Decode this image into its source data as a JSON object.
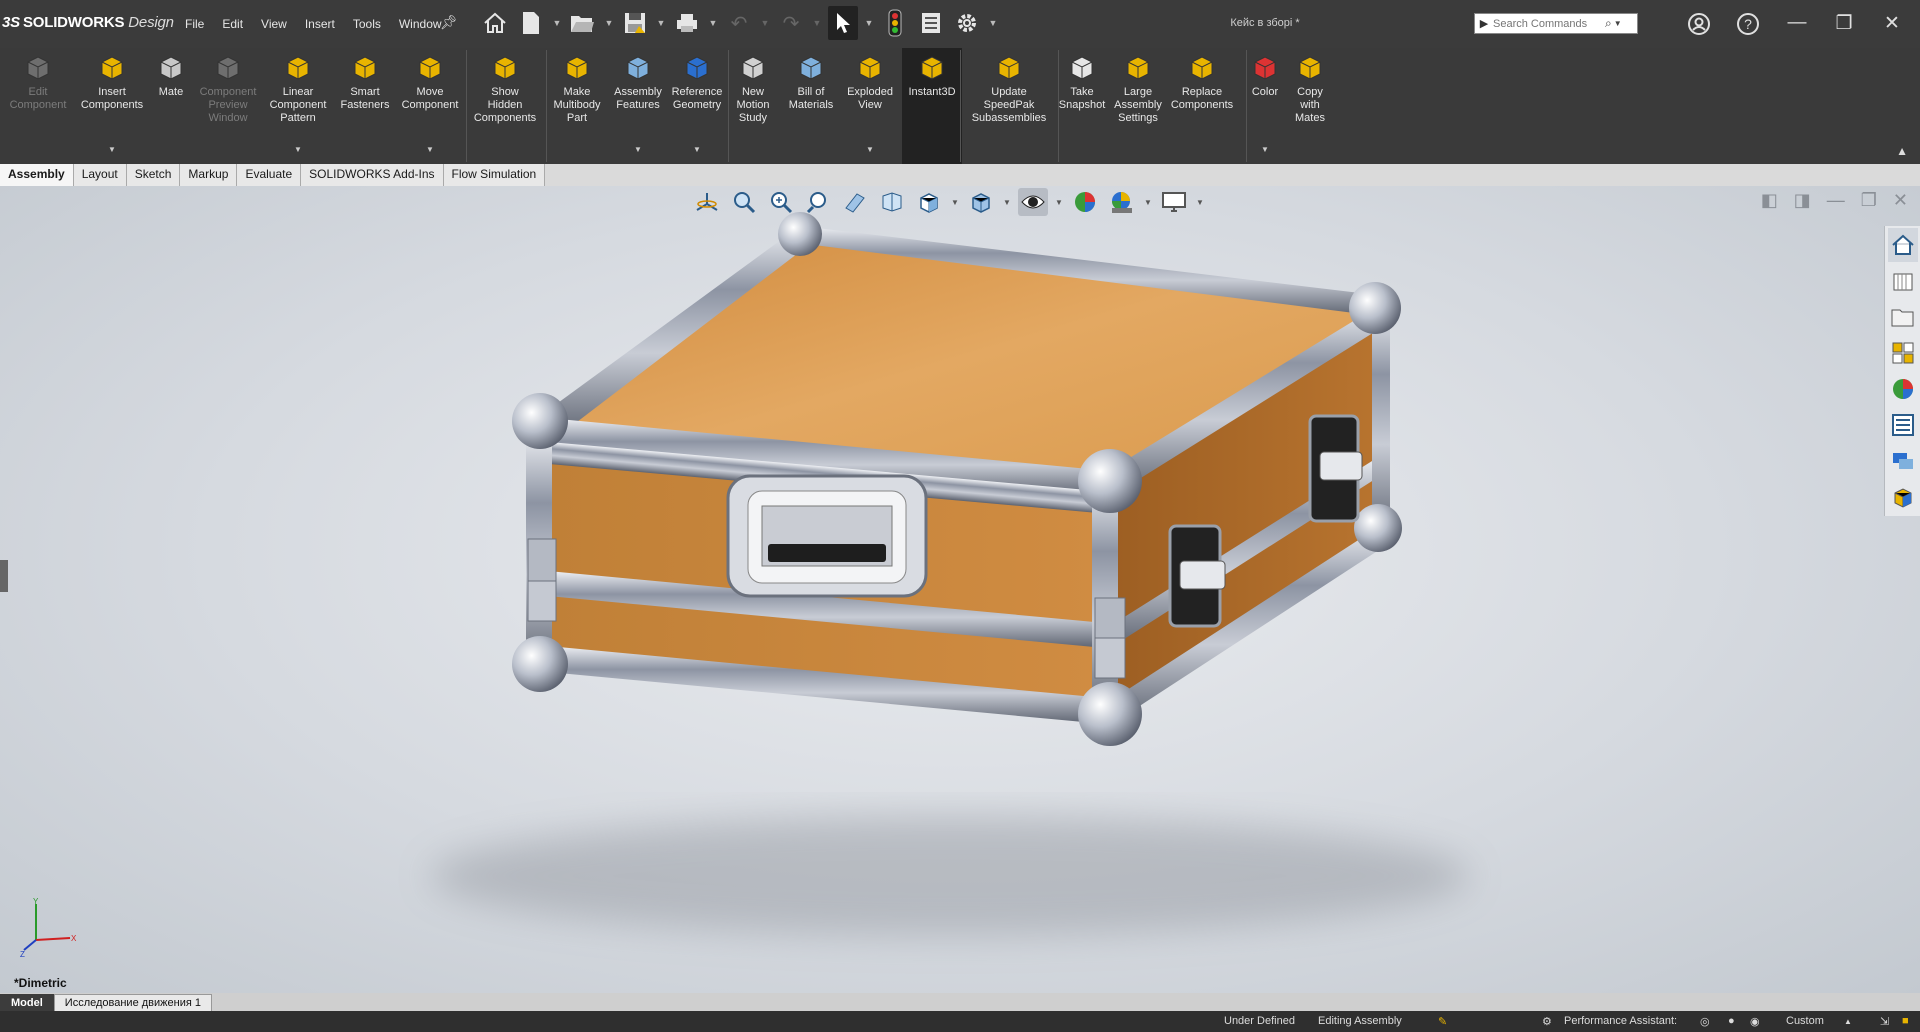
{
  "app": {
    "logo_prefix": "3S",
    "logo": "SOLIDWORKS",
    "logo_suffix": "Design",
    "document_title": "Кейс в зборі *"
  },
  "menu": [
    "File",
    "Edit",
    "View",
    "Insert",
    "Tools",
    "Window"
  ],
  "search": {
    "placeholder": "Search Commands"
  },
  "ribbon": [
    {
      "label": "Edit\nComponent",
      "icon": "edit-component-icon",
      "disabled": true
    },
    {
      "label": "Insert\nComponents",
      "icon": "insert-components-icon",
      "disabled": false
    },
    {
      "label": "Mate",
      "icon": "mate-paperclip-icon",
      "disabled": false
    },
    {
      "label": "Component\nPreview\nWindow",
      "icon": "component-preview-icon",
      "disabled": true
    },
    {
      "label": "Linear\nComponent\nPattern",
      "icon": "linear-pattern-icon",
      "disabled": false
    },
    {
      "label": "Smart\nFasteners",
      "icon": "smart-fasteners-icon",
      "disabled": false
    },
    {
      "label": "Move\nComponent",
      "icon": "move-component-icon",
      "disabled": false
    },
    {
      "label": "Show\nHidden\nComponents",
      "icon": "show-hidden-icon",
      "disabled": false
    },
    {
      "label": "Make\nMultibody\nPart",
      "icon": "multibody-part-icon",
      "disabled": false
    },
    {
      "label": "Assembly\nFeatures",
      "icon": "assembly-features-icon",
      "disabled": false
    },
    {
      "label": "Reference\nGeometry",
      "icon": "reference-geometry-icon",
      "disabled": false
    },
    {
      "label": "New\nMotion\nStudy",
      "icon": "motion-study-icon",
      "disabled": false
    },
    {
      "label": "Bill of\nMaterials",
      "icon": "bill-of-materials-icon",
      "disabled": false
    },
    {
      "label": "Exploded\nView",
      "icon": "exploded-view-icon",
      "disabled": false
    },
    {
      "label": "Instant3D",
      "icon": "instant3d-icon",
      "disabled": false,
      "selected": true
    },
    {
      "label": "Update\nSpeedPak\nSubassemblies",
      "icon": "speedpak-icon",
      "disabled": false
    },
    {
      "label": "Take\nSnapshot",
      "icon": "camera-icon",
      "disabled": false
    },
    {
      "label": "Large\nAssembly\nSettings",
      "icon": "large-assembly-icon",
      "disabled": false
    },
    {
      "label": "Replace\nComponents",
      "icon": "replace-components-icon",
      "disabled": false
    },
    {
      "label": "Color",
      "icon": "color-palette-icon",
      "disabled": false
    },
    {
      "label": "Copy\nwith\nMates",
      "icon": "copy-with-mates-icon",
      "disabled": false
    }
  ],
  "tabs": [
    "Assembly",
    "Layout",
    "Sketch",
    "Markup",
    "Evaluate",
    "SOLIDWORKS Add-Ins",
    "Flow Simulation"
  ],
  "viewport": {
    "view_label": "*Dimetric",
    "triad": {
      "x": "X",
      "y": "Y",
      "z": "Z"
    }
  },
  "model_tabs": [
    "Model",
    "Исследование движения 1"
  ],
  "status": {
    "under_defined": "Under Defined",
    "editing": "Editing Assembly",
    "perf": "Performance Assistant:",
    "units": "Custom",
    "units_arrow": "▲"
  },
  "colors": {
    "wood": "#d99a4d",
    "frame": "#8e95a3",
    "accent": "#2b5c8a",
    "chrome_dark": "#3a3a3a"
  }
}
